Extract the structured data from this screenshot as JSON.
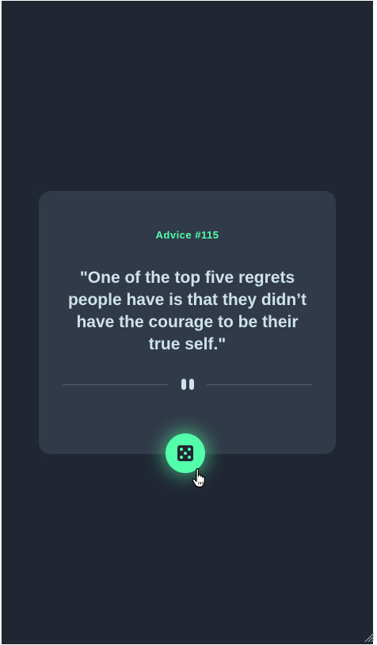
{
  "card": {
    "advice_id": "Advice #115",
    "quote": "\"One of the top five regrets people have is that they didn’t have the courage to be their true self.\""
  },
  "icons": {
    "divider": "pause-icon",
    "button": "dice-icon",
    "pointer": "hand-pointer-icon",
    "corner": "resize-grip-icon"
  },
  "colors": {
    "background": "#202733",
    "card": "#313a48",
    "accent": "#53ffaa",
    "text": "#cee3e9",
    "divider": "#4f5d74"
  }
}
